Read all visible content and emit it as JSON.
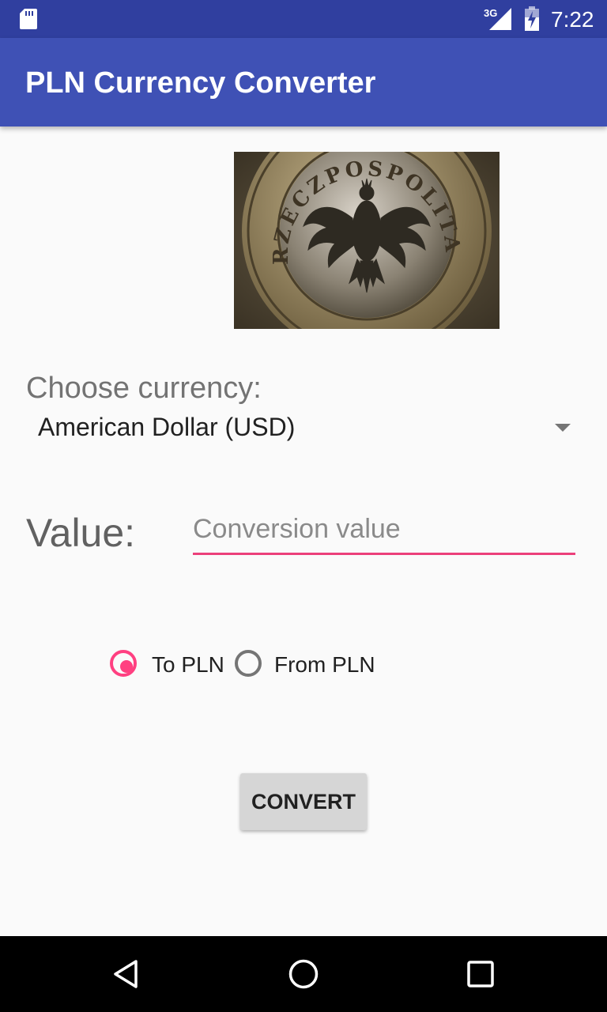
{
  "status_bar": {
    "network": "3G",
    "time": "7:22",
    "icons": [
      "sd-card-icon",
      "signal-icon",
      "battery-charging-icon"
    ]
  },
  "app_bar": {
    "title": "PLN Currency Converter",
    "color": "#3f51b5"
  },
  "coin_image": {
    "inscription": "RZECZPOSPOLITA POLSKA"
  },
  "currency": {
    "label": "Choose currency:",
    "selected": "American Dollar (USD)"
  },
  "value": {
    "label": "Value:",
    "input_value": "",
    "placeholder": "Conversion value"
  },
  "direction": {
    "to_label": "To PLN",
    "from_label": "From PLN",
    "selected": "To PLN",
    "accent_color": "#ff4081"
  },
  "convert_button": {
    "label": "CONVERT"
  },
  "nav_bar": {
    "icons": [
      "back-icon",
      "home-icon",
      "recents-icon"
    ]
  }
}
